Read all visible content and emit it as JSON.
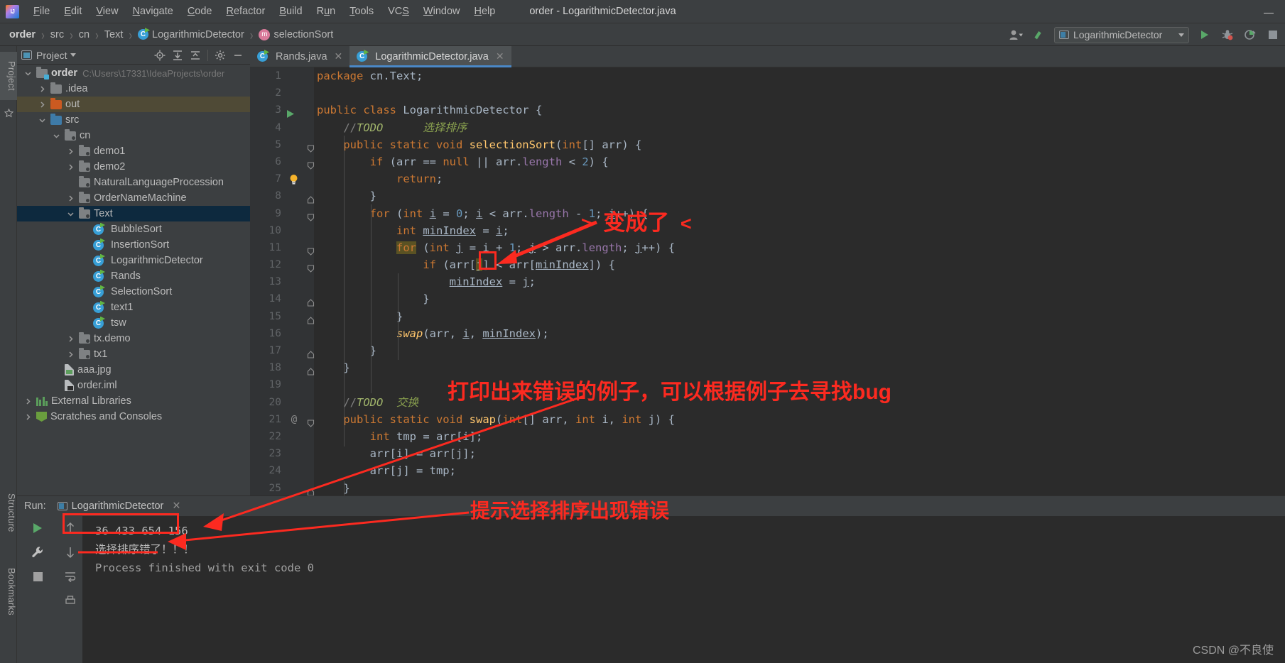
{
  "window": {
    "title": "order - LogarithmicDetector.java",
    "logo_text": "IJ",
    "minimize": "—",
    "maximize": "❐",
    "close": "✕"
  },
  "menu": {
    "items": [
      "File",
      "Edit",
      "View",
      "Navigate",
      "Code",
      "Refactor",
      "Build",
      "Run",
      "Tools",
      "VCS",
      "Window",
      "Help"
    ]
  },
  "breadcrumb": {
    "items": [
      {
        "label": "order",
        "icon": "none",
        "bold": true
      },
      {
        "label": "src",
        "icon": "none",
        "bold": false
      },
      {
        "label": "cn",
        "icon": "none",
        "bold": false
      },
      {
        "label": "Text",
        "icon": "none",
        "bold": false
      },
      {
        "label": "LogarithmicDetector",
        "icon": "class-icon",
        "bold": false
      },
      {
        "label": "selectionSort",
        "icon": "method-icon",
        "bold": false
      }
    ],
    "separator": "›"
  },
  "toolbar_right": {
    "user_icon": "user-icon",
    "vcs_update_icon": "vcs-update-icon",
    "run_config_label": "LogarithmicDetector",
    "run_icon": "run-icon",
    "debug_icon": "debug-icon",
    "coverage_icon": "coverage-icon",
    "stop_icon": "stop-icon"
  },
  "left_rail": {
    "project_tab": "Project",
    "structure_tab": "Structure",
    "bookmarks_tab": "Bookmarks",
    "favorites_icon": "star-icon"
  },
  "project_panel": {
    "title": "Project",
    "dropdown_caret": "▾",
    "actions": [
      "locate-icon",
      "expand-all-icon",
      "collapse-all-icon",
      "settings-gear-icon",
      "hide-icon"
    ],
    "tree": [
      {
        "label": "order",
        "path": "C:\\Users\\17331\\IdeaProjects\\order",
        "depth": 0,
        "twisty": "down",
        "icon": "module-folder",
        "bold": true,
        "state": "none"
      },
      {
        "label": ".idea",
        "path": "",
        "depth": 1,
        "twisty": "right",
        "icon": "folder-gray",
        "bold": false,
        "state": "none"
      },
      {
        "label": "out",
        "path": "",
        "depth": 1,
        "twisty": "right",
        "icon": "folder-orange",
        "bold": false,
        "state": "olive"
      },
      {
        "label": "src",
        "path": "",
        "depth": 1,
        "twisty": "down",
        "icon": "folder-blue",
        "bold": false,
        "state": "none"
      },
      {
        "label": "cn",
        "path": "",
        "depth": 2,
        "twisty": "down",
        "icon": "package",
        "bold": false,
        "state": "none"
      },
      {
        "label": "demo1",
        "path": "",
        "depth": 3,
        "twisty": "right",
        "icon": "package",
        "bold": false,
        "state": "none"
      },
      {
        "label": "demo2",
        "path": "",
        "depth": 3,
        "twisty": "right",
        "icon": "package",
        "bold": false,
        "state": "none"
      },
      {
        "label": "NaturalLanguageProcession",
        "path": "",
        "depth": 3,
        "twisty": "none",
        "icon": "package",
        "bold": false,
        "state": "none"
      },
      {
        "label": "OrderNameMachine",
        "path": "",
        "depth": 3,
        "twisty": "right",
        "icon": "package",
        "bold": false,
        "state": "none"
      },
      {
        "label": "Text",
        "path": "",
        "depth": 3,
        "twisty": "down",
        "icon": "package",
        "bold": false,
        "state": "blue"
      },
      {
        "label": "BubbleSort",
        "path": "",
        "depth": 4,
        "twisty": "none",
        "icon": "class",
        "bold": false,
        "state": "none"
      },
      {
        "label": "InsertionSort",
        "path": "",
        "depth": 4,
        "twisty": "none",
        "icon": "class",
        "bold": false,
        "state": "none"
      },
      {
        "label": "LogarithmicDetector",
        "path": "",
        "depth": 4,
        "twisty": "none",
        "icon": "class",
        "bold": false,
        "state": "none"
      },
      {
        "label": "Rands",
        "path": "",
        "depth": 4,
        "twisty": "none",
        "icon": "class",
        "bold": false,
        "state": "none"
      },
      {
        "label": "SelectionSort",
        "path": "",
        "depth": 4,
        "twisty": "none",
        "icon": "class",
        "bold": false,
        "state": "none"
      },
      {
        "label": "text1",
        "path": "",
        "depth": 4,
        "twisty": "none",
        "icon": "class",
        "bold": false,
        "state": "none"
      },
      {
        "label": "tsw",
        "path": "",
        "depth": 4,
        "twisty": "none",
        "icon": "class",
        "bold": false,
        "state": "none"
      },
      {
        "label": "tx.demo",
        "path": "",
        "depth": 3,
        "twisty": "right",
        "icon": "package",
        "bold": false,
        "state": "none"
      },
      {
        "label": "tx1",
        "path": "",
        "depth": 3,
        "twisty": "right",
        "icon": "package",
        "bold": false,
        "state": "none"
      },
      {
        "label": "aaa.jpg",
        "path": "",
        "depth": 2,
        "twisty": "none",
        "icon": "image-file",
        "bold": false,
        "state": "none"
      },
      {
        "label": "order.iml",
        "path": "",
        "depth": 2,
        "twisty": "none",
        "icon": "iml-file",
        "bold": false,
        "state": "none"
      },
      {
        "label": "External Libraries",
        "path": "",
        "depth": 0,
        "twisty": "right",
        "icon": "libraries",
        "bold": false,
        "state": "none"
      },
      {
        "label": "Scratches and Consoles",
        "path": "",
        "depth": 0,
        "twisty": "right",
        "icon": "scratches",
        "bold": false,
        "state": "none"
      }
    ]
  },
  "editor": {
    "tabs": [
      {
        "label": "Rands.java",
        "active": false,
        "icon": "java-class-icon",
        "close": "✕"
      },
      {
        "label": "LogarithmicDetector.java",
        "active": true,
        "icon": "java-class-icon",
        "close": "✕"
      }
    ],
    "lines": [
      {
        "n": 1,
        "marker": "none"
      },
      {
        "n": 2,
        "marker": "none"
      },
      {
        "n": 3,
        "marker": "run"
      },
      {
        "n": 4,
        "marker": "none"
      },
      {
        "n": 5,
        "marker": "fold-open"
      },
      {
        "n": 6,
        "marker": "fold-open"
      },
      {
        "n": 7,
        "marker": "bulb"
      },
      {
        "n": 8,
        "marker": "fold-end"
      },
      {
        "n": 9,
        "marker": "fold-open"
      },
      {
        "n": 10,
        "marker": "none"
      },
      {
        "n": 11,
        "marker": "fold-open"
      },
      {
        "n": 12,
        "marker": "fold-open"
      },
      {
        "n": 13,
        "marker": "none"
      },
      {
        "n": 14,
        "marker": "fold-end"
      },
      {
        "n": 15,
        "marker": "fold-end"
      },
      {
        "n": 16,
        "marker": "none"
      },
      {
        "n": 17,
        "marker": "fold-end"
      },
      {
        "n": 18,
        "marker": "fold-end"
      },
      {
        "n": 19,
        "marker": "none"
      },
      {
        "n": 20,
        "marker": "none"
      },
      {
        "n": 21,
        "marker": "at-fold"
      },
      {
        "n": 22,
        "marker": "none"
      },
      {
        "n": 23,
        "marker": "none"
      },
      {
        "n": 24,
        "marker": "none"
      },
      {
        "n": 25,
        "marker": "fold-end"
      }
    ],
    "source_text": [
      "package cn.Text;",
      "",
      "public class LogarithmicDetector {",
      "    //TODO     选择排序",
      "    public static void selectionSort(int[] arr) {",
      "        if (arr == null || arr.length < 2) {",
      "            return;",
      "        }",
      "        for (int i = 0; i < arr.length - 1; i++) {",
      "            int minIndex = i;",
      "            for (int j = i + 1; j > arr.length; j++) {",
      "                if (arr[j] < arr[minIndex]) {",
      "                    minIndex = j;",
      "                }",
      "            }",
      "            swap(arr, i, minIndex);",
      "        }",
      "    }",
      "",
      "    //TODO  交换",
      "    public static void swap(int[] arr, int i, int j) {",
      "        int tmp = arr[i];",
      "        arr[i] = arr[j];",
      "        arr[j] = tmp;",
      "    }"
    ]
  },
  "run_panel": {
    "label": "Run:",
    "tab_name": "LogarithmicDetector",
    "tab_close": "✕",
    "side_buttons": [
      "rerun-icon",
      "wrench-icon",
      "stop-icon"
    ],
    "side_buttons2": [
      "up-arrow-icon",
      "down-arrow-icon",
      "soft-wrap-icon",
      "print-icon"
    ],
    "console_lines": [
      "36  433  654  156",
      "选择排序错了！！！",
      "",
      "Process finished with exit code 0"
    ]
  },
  "annotations": {
    "a1_gt": ">",
    "a1_text": "变成了",
    "a1_lt": "<",
    "a2": "打印出来错误的例子，可以根据例子去寻找bug",
    "a3": "提示选择排序出现错误",
    "color": "#fc2a20"
  },
  "watermark": "CSDN @不良使"
}
